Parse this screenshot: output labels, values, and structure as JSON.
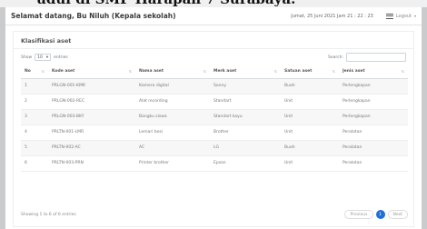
{
  "banner": {
    "text": "udul di SMP Harapan 7 Surabaya."
  },
  "topbar": {
    "welcome": "Selamat datang, Bu Niluh (Kepala sekolah)",
    "datetime": "Jumat, 25 Juni 2021  Jam 21 : 22 : 23",
    "logout": "Logout",
    "menu_icon": "hamburger-icon"
  },
  "card": {
    "title": "Klasifikasi aset"
  },
  "controls": {
    "show_label": "Show",
    "entries_value": "10",
    "entries_label": "entries",
    "search_label": "Search:",
    "search_value": ""
  },
  "table": {
    "headers": [
      "No",
      "Kode aset",
      "Nama aset",
      "Merk aset",
      "Satuan aset",
      "Jenis aset"
    ],
    "rows": [
      [
        "1",
        "PRLGN-001-KMR",
        "Kamera digital",
        "Sonny",
        "Buah",
        "Perlengkapan"
      ],
      [
        "2",
        "PRLGN-002-REC",
        "Alat recording",
        "Standart",
        "Unit",
        "Perlengkapan"
      ],
      [
        "3",
        "PRLGN-003-BKY",
        "Bangku siswa",
        "Standart kayu",
        "Unit",
        "Perlengkapan"
      ],
      [
        "4",
        "PRLTN-001-LMR",
        "Lemari besi",
        "Brother",
        "Unit",
        "Peralatan"
      ],
      [
        "5",
        "PRLTN-002-AC",
        "AC",
        "LG",
        "Buah",
        "Peralatan"
      ],
      [
        "6",
        "PRLTN-003-PRN",
        "Printer brother",
        "Epson",
        "Unit",
        "Peralatan"
      ]
    ]
  },
  "footer": {
    "info": "Showing 1 to 6 of 6 entries",
    "previous": "Previous",
    "current_page": "1",
    "next": "Next"
  },
  "colors": {
    "accent": "#1f6fd8",
    "background": "#c9cbcc"
  }
}
